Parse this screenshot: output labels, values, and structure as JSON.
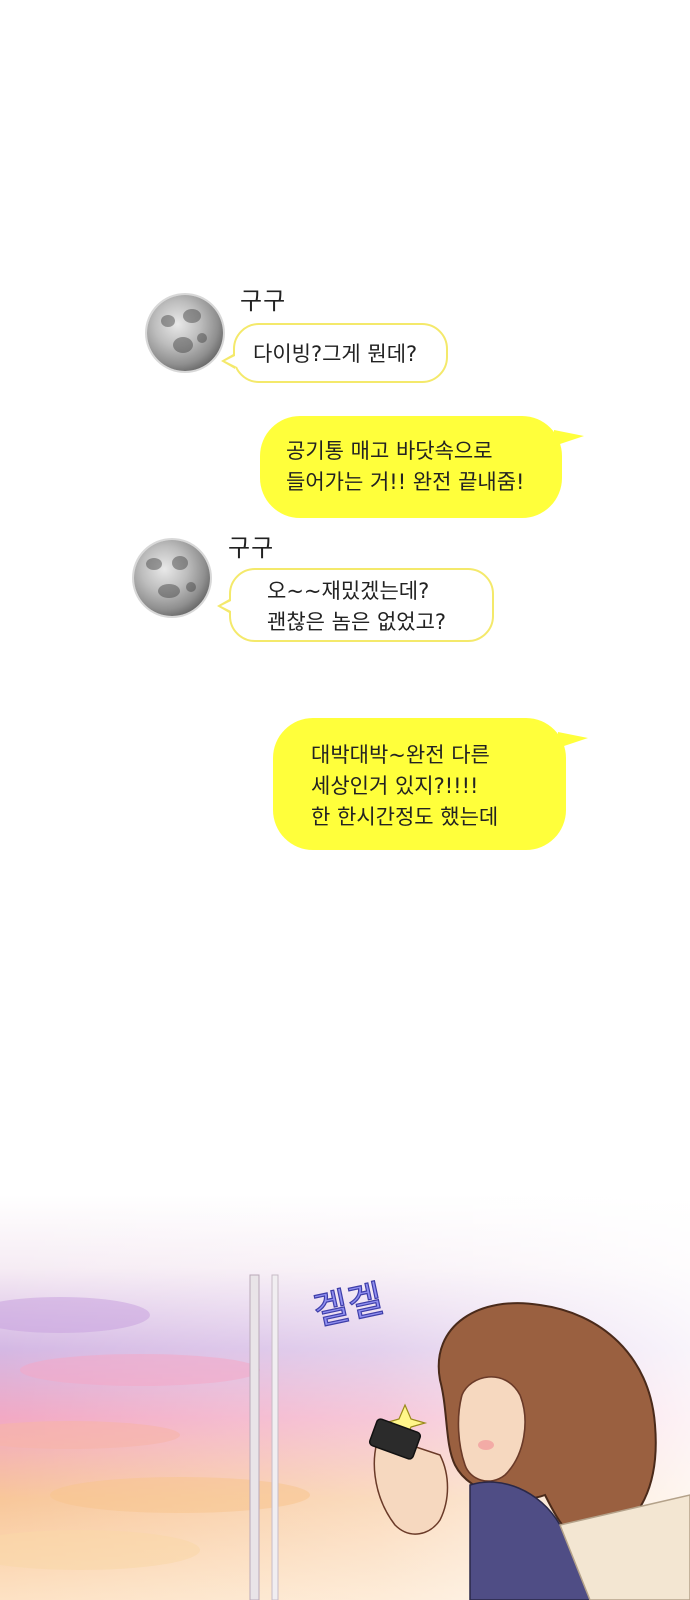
{
  "chat": {
    "msg1": {
      "sender": "구구",
      "text": "다이빙?그게 뭔데?"
    },
    "msg2": {
      "lines": [
        "공기통 매고 바닷속으로",
        "들어가는 거!! 완전 끝내줌!"
      ]
    },
    "msg3": {
      "sender": "구구",
      "lines": [
        "오~~재밌겠는데?",
        "괜찮은 놈은 없었고?"
      ]
    },
    "msg4": {
      "lines": [
        "대박대박~완전 다른",
        "세상인거 있지?!!!!",
        "한 한시간정도 했는데"
      ]
    }
  },
  "scene": {
    "sfx_text": "겔겔",
    "colors": {
      "sky_pink": "#f2a9c4",
      "sky_purple": "#b89ad8",
      "sky_orange": "#f7c07a",
      "hair": "#8a5a3c"
    }
  },
  "colors": {
    "bubble_out": "#ffff3b",
    "bubble_in_border": "#f4e96b"
  }
}
